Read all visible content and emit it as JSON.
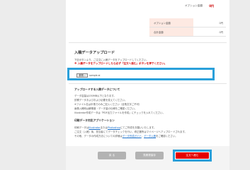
{
  "summary": {
    "option_total_label": "オプション金額",
    "option_total_value": "0円",
    "rows": [
      {
        "label": "オプション金額",
        "value": "0円"
      },
      {
        "label": "合計金額",
        "value": "0円"
      }
    ]
  },
  "upload": {
    "title": "入稿データアップロード",
    "instructions": "下記ボタンより、ご注文に入稿データをアップロードしてください。",
    "warning": "※ 入稿データをアップロードしたら必ず「注文へ進む」ボタンを押下ください。",
    "file_button_label": "参照...",
    "file_name": "sample.ai"
  },
  "uploadable": {
    "title": "アップロードする入稿データについて",
    "lines": [
      "データ容量は150MB以下となります。",
      "診察データおよびおよび必要を変えてください。",
      "※ファイル名は半角でのみご記入ください（全角文字ご不可）",
      "画像入稿時は解像度・データ量の仕様をご確認ください。",
      "Illustrator作成データは「PDF出力ファイルを作成」にチェックを入れてください。"
    ]
  },
  "apps": {
    "title": "印刷データ対応アプリケーション",
    "line1_pre": "印刷データは",
    "illustrator": "Illustrator",
    "line1_mid": "または",
    "photoshop": "Photoshop",
    "line1_post": "にてご作成をお願いいたします。",
    "line2": "ご注文（入稿）後、担当者にてデータチェックを行い、修正箇所はマイページへアップロードされます。",
    "line3_pre": "その他、データの作成方法についての詳細は",
    "guide_link": "データ作成ガイド",
    "line3_mid": "、",
    "template_link": "データ入稿",
    "line3_post": "をご確認ください。"
  },
  "footer": {
    "back_label": "戻 る",
    "save_label": "見積書保存",
    "cart_label": "注文へ進む"
  },
  "colors": {
    "accent_red": "#e60000",
    "highlight_blue": "#2aa0da",
    "link_blue": "#1a6fc9"
  }
}
